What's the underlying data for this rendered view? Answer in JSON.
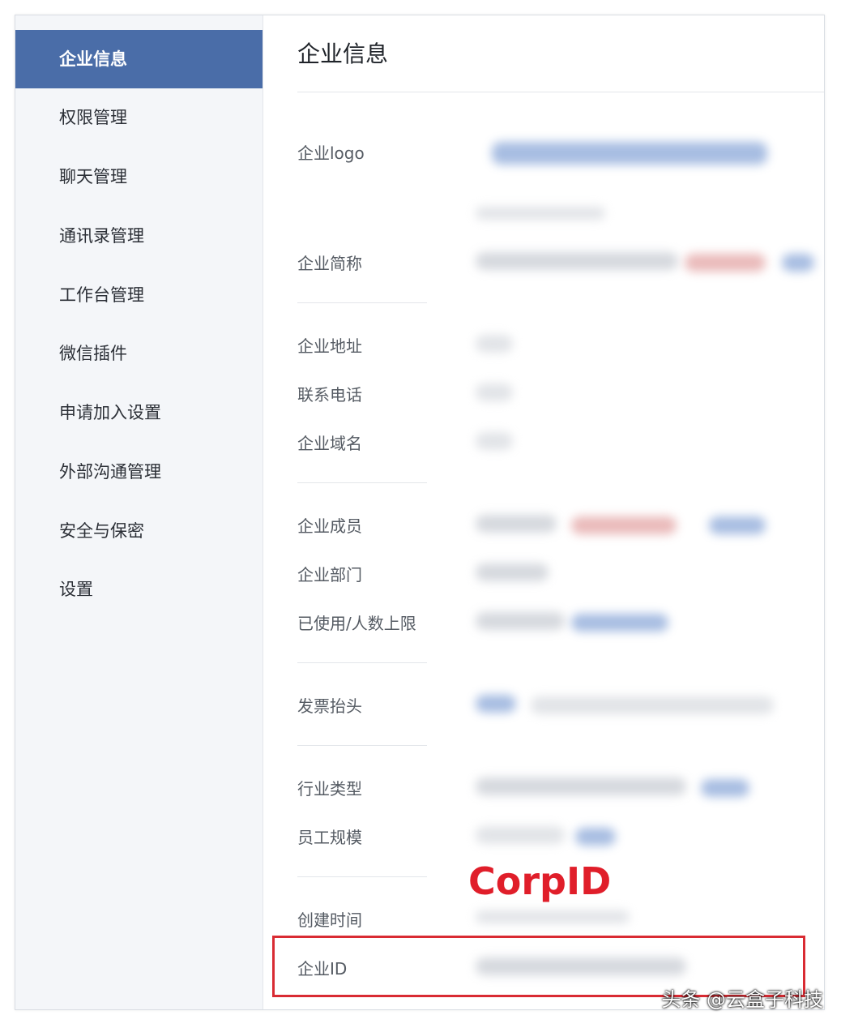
{
  "sidebar": {
    "items": [
      {
        "label": "企业信息",
        "active": true
      },
      {
        "label": "权限管理"
      },
      {
        "label": "聊天管理"
      },
      {
        "label": "通讯录管理"
      },
      {
        "label": "工作台管理"
      },
      {
        "label": "微信插件"
      },
      {
        "label": "申请加入设置"
      },
      {
        "label": "外部沟通管理"
      },
      {
        "label": "安全与保密"
      },
      {
        "label": "设置"
      }
    ]
  },
  "main": {
    "title": "企业信息",
    "fields": {
      "logo": "企业logo",
      "short_name": "企业简称",
      "address": "企业地址",
      "phone": "联系电话",
      "domain": "企业域名",
      "members": "企业成员",
      "departments": "企业部门",
      "usage": "已使用/人数上限",
      "invoice": "发票抬头",
      "industry": "行业类型",
      "staff_size": "员工规模",
      "created": "创建时间",
      "corp_id": "企业ID"
    }
  },
  "annotation": {
    "callout": "CorpID",
    "color": "#e01e2a"
  },
  "watermark": "头条 @云盒子科技",
  "colors": {
    "sidebar_active": "#4a6da8",
    "sidebar_bg": "#f4f6f9"
  }
}
